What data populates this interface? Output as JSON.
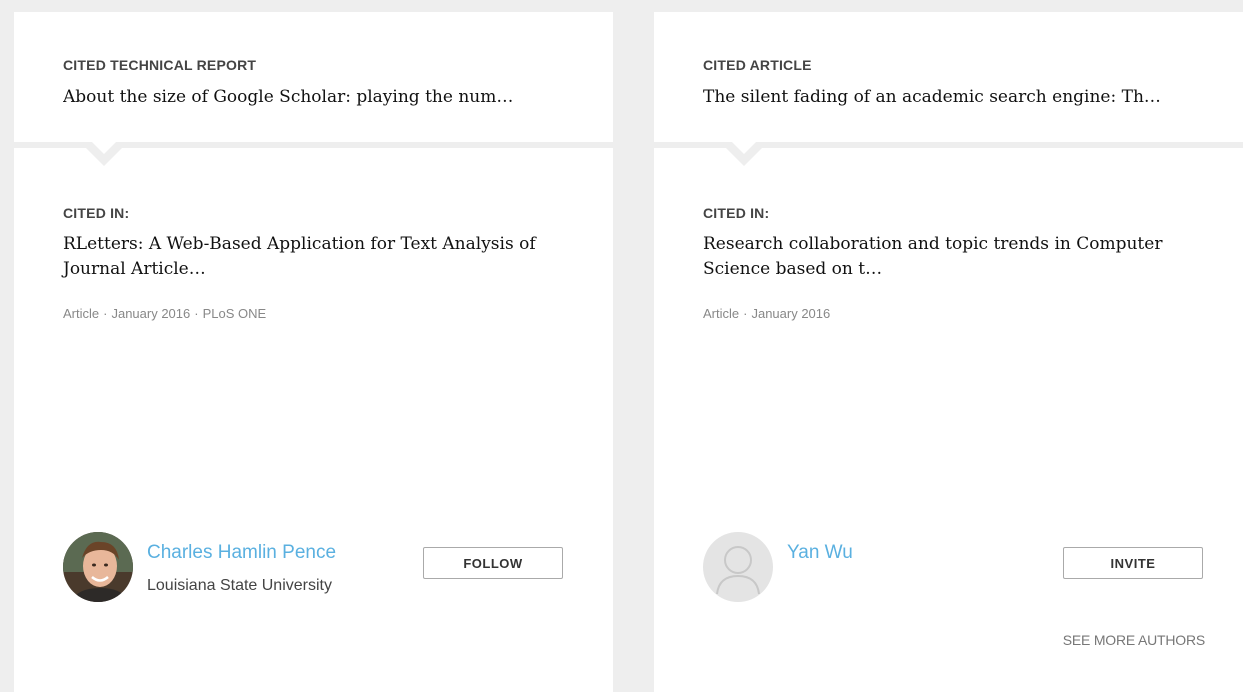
{
  "cards": [
    {
      "cited_label": "CITED TECHNICAL REPORT",
      "cited_title": "About the size of Google Scholar: playing the num…",
      "cited_in_label": "CITED IN:",
      "cited_in_title": "RLetters: A Web-Based Application for Text Analysis of Journal Article…",
      "meta": [
        "Article",
        "January 2016",
        "PLoS ONE"
      ],
      "meta_sep": "·",
      "author": {
        "name": "Charles Hamlin Pence",
        "affiliation": "Louisiana State University",
        "avatar": "photo-avatar"
      },
      "action_label": "FOLLOW"
    },
    {
      "cited_label": "CITED ARTICLE",
      "cited_title": "The silent fading of an academic search engine: Th…",
      "cited_in_label": "CITED IN:",
      "cited_in_title": "Research collaboration and topic trends in Computer Science based on t…",
      "meta": [
        "Article",
        "January 2016"
      ],
      "meta_sep": "·",
      "author": {
        "name": "Yan Wu",
        "affiliation": "",
        "avatar": "default-avatar"
      },
      "action_label": "INVITE",
      "see_more_label": "SEE MORE AUTHORS"
    }
  ],
  "colors": {
    "background": "#eeeeee",
    "card": "#ffffff",
    "link": "#5ab0e0",
    "meta": "#888888"
  }
}
